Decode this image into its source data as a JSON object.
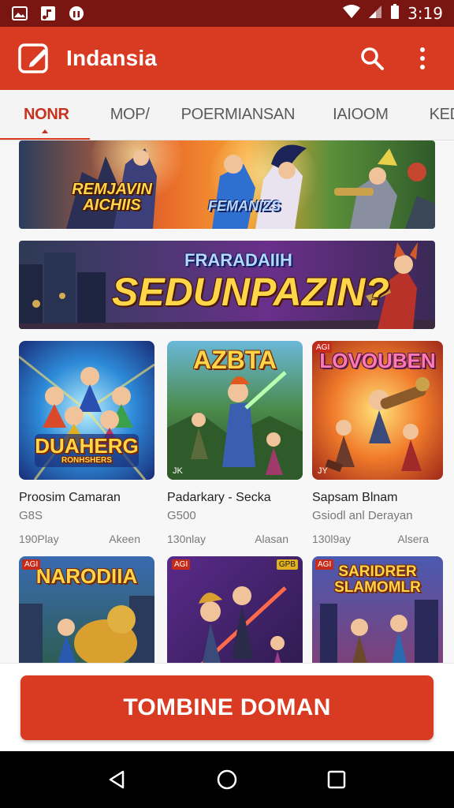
{
  "status_bar": {
    "time": "3:19",
    "icons": [
      "gallery-icon",
      "music-icon",
      "android-icon",
      "wifi-icon",
      "signal-icon",
      "battery-icon"
    ]
  },
  "app_bar": {
    "title": "Indansia",
    "icons": [
      "edit-square-icon",
      "search-icon",
      "more-vertical-icon"
    ]
  },
  "tabs": [
    {
      "label": "NONR",
      "active": true
    },
    {
      "label": "MOP/"
    },
    {
      "label": "POERMIANSAN"
    },
    {
      "label": "IAIOOM"
    },
    {
      "label": "KEDA"
    }
  ],
  "banners": [
    {
      "left_text": "REMJAVIN AICHIIS",
      "right_text": "FEMANIZS"
    },
    {
      "headline_small": "FRARADAIIH",
      "headline": "SEDUNPAZIN?"
    }
  ],
  "cards": [
    {
      "thumb_title": "DUAHERG",
      "thumb_subtitle": "RONHSHERS",
      "name": "Proosim Camaran",
      "sub": "G8S",
      "plays": "190Play",
      "tag": "Akeen"
    },
    {
      "thumb_title": "AZBTA",
      "thumb_badge": "JK",
      "name": "Padarkary - Secka",
      "sub": "G500",
      "plays": "130nlay",
      "tag": "Alasan"
    },
    {
      "thumb_title": "LOVOUBEN",
      "thumb_badge": "AGI",
      "thumb_corner": "JY",
      "name": "Sapsam Blnam",
      "sub": "Gsiodl anl Derayan",
      "plays": "130l9ay",
      "tag": "Alsera"
    },
    {
      "thumb_title": "NARODIIA",
      "thumb_badge": "AGI"
    },
    {
      "thumb_title": "",
      "thumb_badge": "GPB",
      "thumb_badge2": "AGI"
    },
    {
      "thumb_title": "SARIDRER SLAMOMLR",
      "thumb_badge": "AGI"
    }
  ],
  "cta": {
    "label": "TOMBINE DOMAN"
  },
  "nav_bar": {
    "icons": [
      "back-icon",
      "home-icon",
      "recents-icon"
    ]
  },
  "colors": {
    "primary": "#d83a22",
    "status_bar": "#7a1612",
    "active_tab": "#c83320"
  }
}
